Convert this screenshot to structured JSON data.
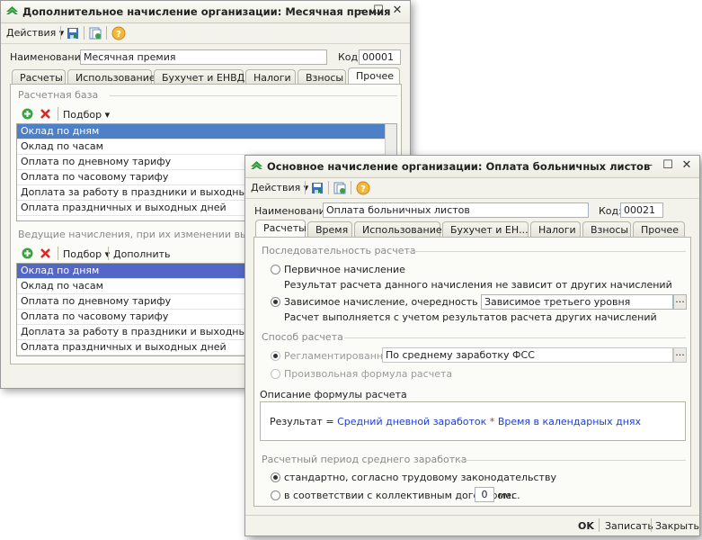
{
  "win1": {
    "title": "Дополнительное начисление организации: Месячная премия",
    "toolbar": {
      "actions": "Действия ▾"
    },
    "name_label": "Наименование:",
    "name_value": "Месячная премия",
    "code_label": "Код:",
    "code_value": "00001",
    "tabs": [
      "Расчеты",
      "Использование",
      "Бухучет и ЕНВД",
      "Налоги",
      "Взносы",
      "Прочее"
    ],
    "active_tab": "Прочее",
    "base_section": "Расчетная база",
    "picker": "Подбор ▾",
    "base_rows": [
      "Оклад по дням",
      "Оклад по часам",
      "Оплата по дневному тарифу",
      "Оплата по часовому тарифу",
      "Доплата за работу в праздники и выходные",
      "Оплата праздничных и выходных дней"
    ],
    "lead_section": "Ведущие начисления, при их изменении выпо...",
    "add_more": "Дополнить",
    "lead_rows": [
      "Оклад по дням",
      "Оклад по часам",
      "Оплата по дневному тарифу",
      "Оплата по часовому тарифу",
      "Доплата за работу в праздники и выходные",
      "Оплата праздничных и выходных дней"
    ]
  },
  "win2": {
    "title": "Основное начисление организации: Оплата больничных листов",
    "toolbar": {
      "actions": "Действия ▾"
    },
    "name_label": "Наименование:",
    "name_value": "Оплата больничных листов",
    "code_label": "Код:",
    "code_value": "00021",
    "tabs": [
      "Расчеты",
      "Время",
      "Использование",
      "Бухучет и ЕН...",
      "Налоги",
      "Взносы",
      "Прочее"
    ],
    "active_tab": "Расчеты",
    "seq_section": "Последовательность расчета",
    "primary_label": "Первичное начисление",
    "primary_desc": "Результат расчета данного начисления не зависит от других начислений",
    "dependent_label": "Зависимое начисление, очередность расчета:",
    "dependent_value": "Зависимое третьего уровня",
    "dependent_desc": "Расчет выполняется с учетом результатов расчета других начислений",
    "method_section": "Способ расчета",
    "regulated_label": "Регламентированный:",
    "regulated_value": "По среднему заработку ФСС",
    "arbitrary_label": "Произвольная формула расчета",
    "formula_section": "Описание формулы расчета",
    "formula": {
      "result": "Результат",
      "eq": " = ",
      "term1": "Средний дневной заработок",
      "op": " * ",
      "term2": "Время в календарных днях"
    },
    "period_section": "Расчетный период среднего заработка",
    "standard_label": "стандартно, согласно трудовому законодательству",
    "collective_label": "в соответствии с коллективным договором:",
    "collective_value": "0",
    "months": "мес.",
    "ok": "OK",
    "save": "Записать",
    "close": "Закрыть"
  }
}
